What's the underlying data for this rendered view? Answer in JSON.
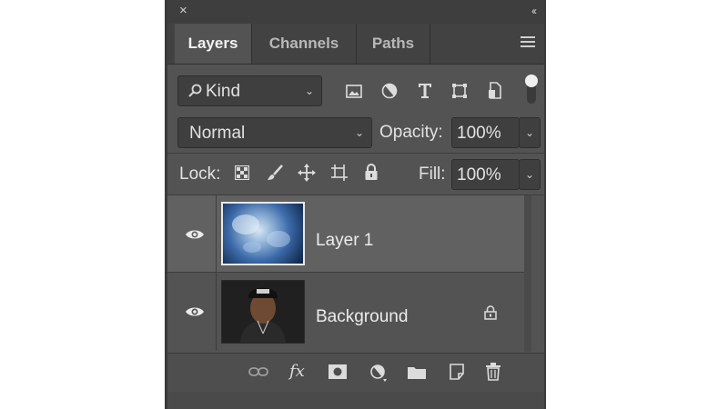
{
  "panel": {
    "close_glyph": "×",
    "collapse_glyph": "‹‹",
    "tabs": [
      {
        "label": "Layers",
        "active": true
      },
      {
        "label": "Channels",
        "active": false
      },
      {
        "label": "Paths",
        "active": false
      }
    ],
    "menu_icon": "hamburger-menu-icon"
  },
  "filter": {
    "kind_label": "Kind",
    "filter_icons": [
      "image-filter-icon",
      "adjustment-filter-icon",
      "type-filter-icon",
      "shape-filter-icon",
      "smart-object-filter-icon"
    ]
  },
  "blend": {
    "mode": "Normal",
    "opacity_label": "Opacity:",
    "opacity_value": "100%"
  },
  "lock": {
    "label": "Lock:",
    "icons": [
      "lock-transparent-pixels-icon",
      "lock-image-pixels-icon",
      "lock-position-icon",
      "prevent-auto-nesting-icon",
      "lock-all-icon"
    ],
    "fill_label": "Fill:",
    "fill_value": "100%"
  },
  "layers": [
    {
      "name": "Layer 1",
      "visible": true,
      "selected": true,
      "locked": false
    },
    {
      "name": "Background",
      "visible": true,
      "selected": false,
      "locked": true
    }
  ],
  "footer_icons": [
    "link-layers-icon",
    "fx-icon",
    "add-mask-icon",
    "adjustment-layer-icon",
    "new-group-icon",
    "new-layer-icon",
    "delete-layer-icon"
  ],
  "footer": {
    "fx_label": "fx"
  },
  "colors": {
    "panel_bg": "#535353",
    "selected_row": "#616161",
    "control_bg": "#3f3f3f"
  }
}
